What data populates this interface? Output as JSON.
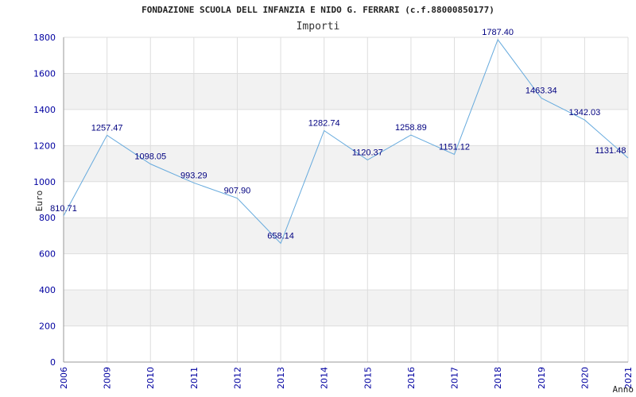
{
  "chart_data": {
    "type": "line",
    "title": "FONDAZIONE SCUOLA DELL INFANZIA E NIDO G. FERRARI (c.f.88000850177)",
    "subtitle": "Importi",
    "xlabel": "Anno",
    "ylabel": "Euro",
    "ylim": [
      0,
      1800
    ],
    "yticks": [
      0,
      200,
      400,
      600,
      800,
      1000,
      1200,
      1400,
      1600,
      1800
    ],
    "categories": [
      "2006",
      "2009",
      "2010",
      "2011",
      "2012",
      "2013",
      "2014",
      "2015",
      "2016",
      "2017",
      "2018",
      "2019",
      "2020",
      "2021"
    ],
    "values": [
      810.71,
      1257.47,
      1098.05,
      993.29,
      907.9,
      658.14,
      1282.74,
      1120.37,
      1258.89,
      1151.12,
      1787.4,
      1463.34,
      1342.03,
      1131.48
    ],
    "value_labels": [
      "810.71",
      "1257.47",
      "1098.05",
      "993.29",
      "907.90",
      "658.14",
      "1282.74",
      "1120.37",
      "1258.89",
      "1151.12",
      "1787.40",
      "1463.34",
      "1342.03",
      "1131.48"
    ],
    "line_color": "#66aadd",
    "band_color": "#f2f2f2",
    "grid": true
  }
}
